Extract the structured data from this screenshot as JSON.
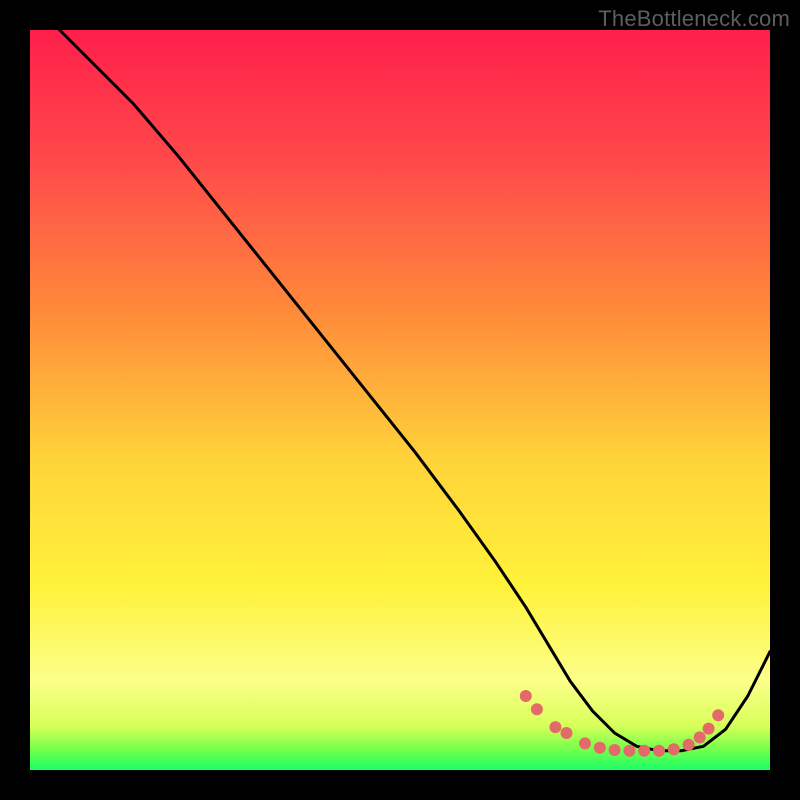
{
  "watermark": "TheBottleneck.com",
  "gradient_stops": [
    {
      "pct": 0,
      "color": "#ff1f4b"
    },
    {
      "pct": 18,
      "color": "#ff4a4a"
    },
    {
      "pct": 38,
      "color": "#ff8a3a"
    },
    {
      "pct": 58,
      "color": "#ffd33a"
    },
    {
      "pct": 75,
      "color": "#fff23a"
    },
    {
      "pct": 88,
      "color": "#fcff8a"
    },
    {
      "pct": 94,
      "color": "#d8ff59"
    },
    {
      "pct": 97,
      "color": "#7bff4a"
    },
    {
      "pct": 100,
      "color": "#1aff66"
    }
  ],
  "chart_data": {
    "type": "line",
    "title": "",
    "xlabel": "",
    "ylabel": "",
    "xlim": [
      0,
      100
    ],
    "ylim": [
      0,
      100
    ],
    "grid": false,
    "legend": false,
    "series": [
      {
        "name": "bottleneck-curve",
        "color": "#000000",
        "x": [
          4,
          8,
          14,
          20,
          28,
          36,
          44,
          52,
          58,
          63,
          67,
          70,
          73,
          76,
          79,
          82,
          85,
          88,
          91,
          94,
          97,
          100
        ],
        "y": [
          100,
          96,
          90,
          83,
          73,
          63,
          53,
          43,
          35,
          28,
          22,
          17,
          12,
          8,
          5,
          3.2,
          2.6,
          2.6,
          3.2,
          5.5,
          10,
          16
        ]
      }
    ],
    "markers": {
      "name": "highlight-dots",
      "color": "#e46a6a",
      "radius_px": 6,
      "points": [
        {
          "x": 67.0,
          "y": 10.0
        },
        {
          "x": 68.5,
          "y": 8.2
        },
        {
          "x": 71.0,
          "y": 5.8
        },
        {
          "x": 72.5,
          "y": 5.0
        },
        {
          "x": 75.0,
          "y": 3.6
        },
        {
          "x": 77.0,
          "y": 3.0
        },
        {
          "x": 79.0,
          "y": 2.7
        },
        {
          "x": 81.0,
          "y": 2.6
        },
        {
          "x": 83.0,
          "y": 2.6
        },
        {
          "x": 85.0,
          "y": 2.6
        },
        {
          "x": 87.0,
          "y": 2.8
        },
        {
          "x": 89.0,
          "y": 3.4
        },
        {
          "x": 90.5,
          "y": 4.4
        },
        {
          "x": 91.7,
          "y": 5.6
        },
        {
          "x": 93.0,
          "y": 7.4
        }
      ]
    }
  }
}
